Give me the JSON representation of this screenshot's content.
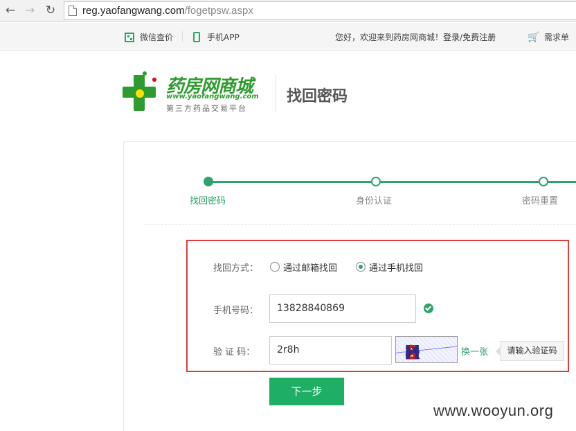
{
  "browser": {
    "url_domain": "reg.yaofangwang.com",
    "url_path": "/fogetpsw.aspx",
    "back_icon": "arrow-left",
    "forward_icon": "arrow-right",
    "reload_icon": "reload"
  },
  "topbar": {
    "wechat_label": "微信查价",
    "app_label": "手机APP",
    "welcome_text": "您好，欢迎来到药房网商城！",
    "login_label": "登录",
    "separator": " /",
    "register_label": "免费注册",
    "cart_label": "需求单"
  },
  "header": {
    "logo_name": "药房网商城",
    "logo_url": "www.yaofangwang.com",
    "logo_slogan": "第三方药品交易平台",
    "page_title": "找回密码"
  },
  "steps": [
    {
      "label": "找回密码",
      "active": true
    },
    {
      "label": "身份认证",
      "active": false
    },
    {
      "label": "密码重置",
      "active": false
    }
  ],
  "form": {
    "method_label": "找回方式：",
    "method_options": [
      {
        "label": "通过邮箱找回",
        "checked": false
      },
      {
        "label": "通过手机找回",
        "checked": true
      }
    ],
    "phone_label": "手机号码：",
    "phone_value": "13828840869",
    "captcha_label": "验 证 码：",
    "captcha_value": "2r8h",
    "captcha_image_text": [
      "2",
      "R",
      "&",
      "H"
    ],
    "refresh_label": "换一张",
    "captcha_tooltip": "请输入验证码",
    "next_button": "下一步"
  },
  "watermark": "www.wooyun.org",
  "colors": {
    "accent": "#2fa36b",
    "button": "#1fae65",
    "highlight_border": "#e03c3c",
    "logo_green": "#2d9b2d",
    "logo_yellow": "#ffe000"
  }
}
